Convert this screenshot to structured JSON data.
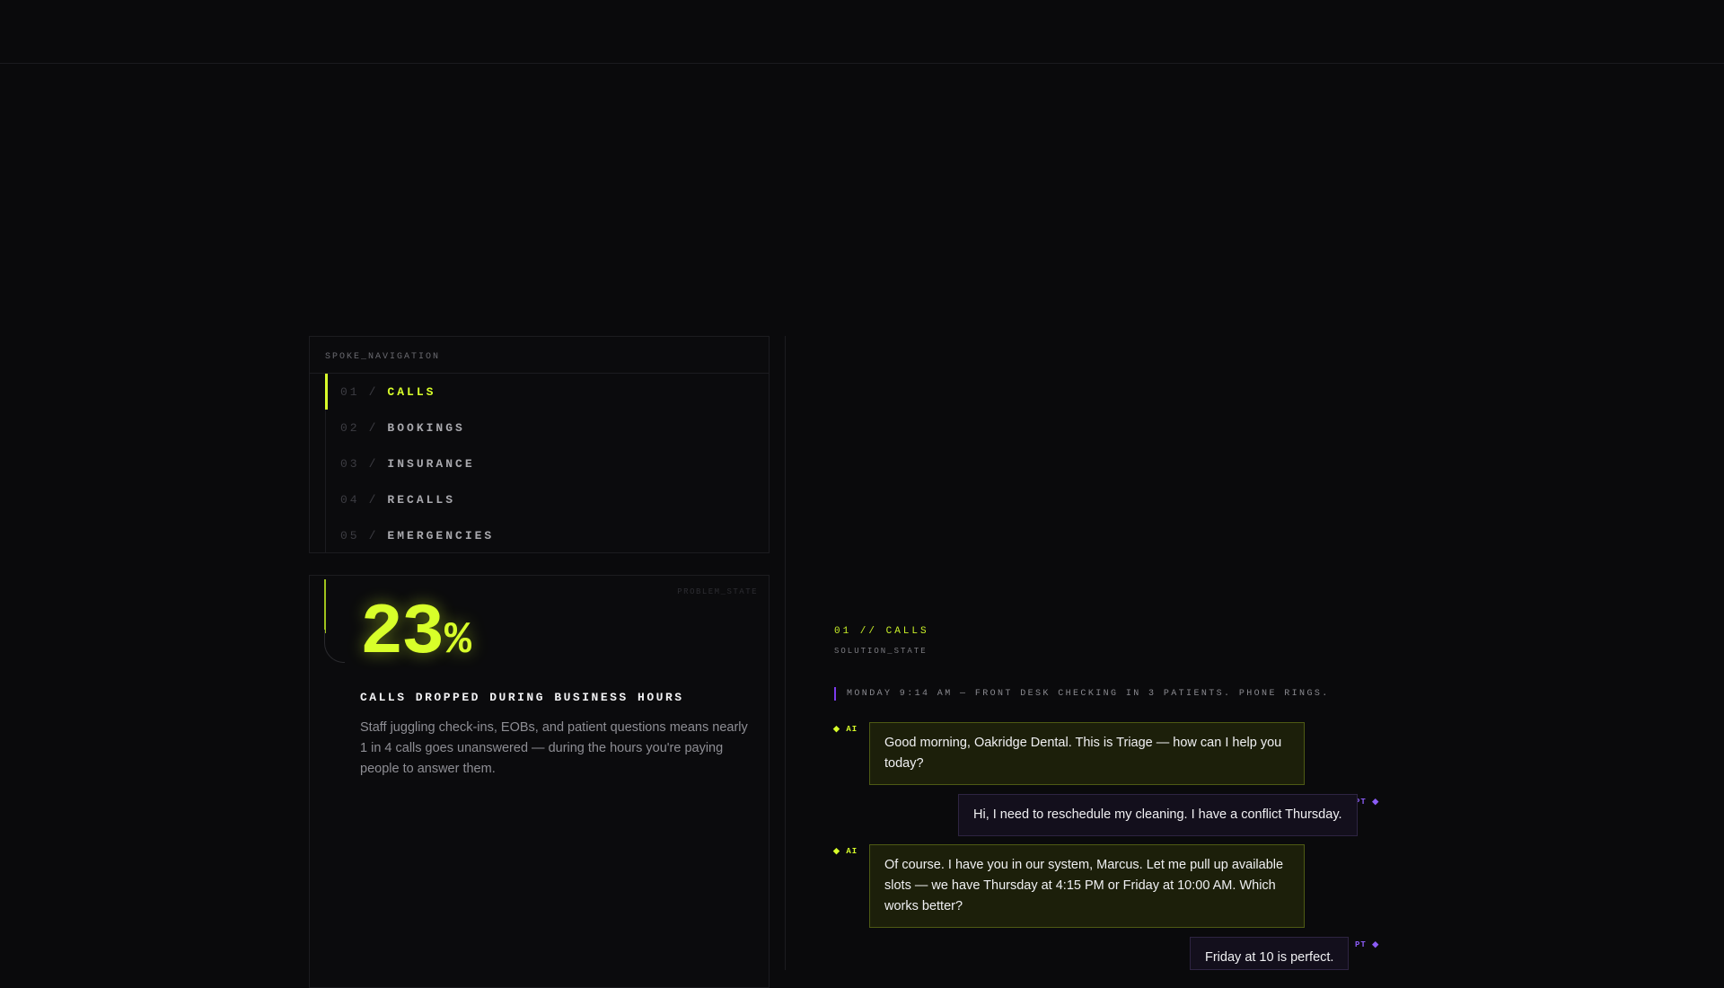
{
  "nav": {
    "header": "SPOKE_NAVIGATION",
    "items": [
      {
        "num": "01",
        "sep": "/",
        "label": "CALLS",
        "active": true
      },
      {
        "num": "02",
        "sep": "/",
        "label": "BOOKINGS",
        "active": false
      },
      {
        "num": "03",
        "sep": "/",
        "label": "INSURANCE",
        "active": false
      },
      {
        "num": "04",
        "sep": "/",
        "label": "RECALLS",
        "active": false
      },
      {
        "num": "05",
        "sep": "/",
        "label": "EMERGENCIES",
        "active": false
      }
    ]
  },
  "problem": {
    "tag": "PROBLEM_STATE",
    "value": "23",
    "unit": "%",
    "label": "CALLS DROPPED DURING BUSINESS HOURS",
    "description": "Staff juggling check-ins, EOBs, and patient questions means nearly 1 in 4 calls goes unanswered — during the hours you're paying people to answer them."
  },
  "solution": {
    "kicker": "01 // CALLS",
    "state": "SOLUTION_STATE",
    "scene": "MONDAY 9:14 AM — FRONT DESK CHECKING IN 3 PATIENTS. PHONE RINGS.",
    "ai_label": "◆ AI",
    "pt_label": "PT ◆",
    "messages": [
      {
        "speaker": "ai",
        "text": "Good morning, Oakridge Dental. This is Triage — how can I help you today?"
      },
      {
        "speaker": "pt",
        "text": "Hi, I need to reschedule my cleaning. I have a conflict Thursday."
      },
      {
        "speaker": "ai",
        "text": "Of course. I have you in our system, Marcus. Let me pull up available slots — we have Thursday at 4:15 PM or Friday at 10:00 AM. Which works better?"
      },
      {
        "speaker": "pt",
        "text": "Friday at 10 is perfect."
      }
    ]
  },
  "colors": {
    "accent": "#d8ff2a",
    "secondary": "#7c3aed",
    "background": "#0a0a0c"
  }
}
